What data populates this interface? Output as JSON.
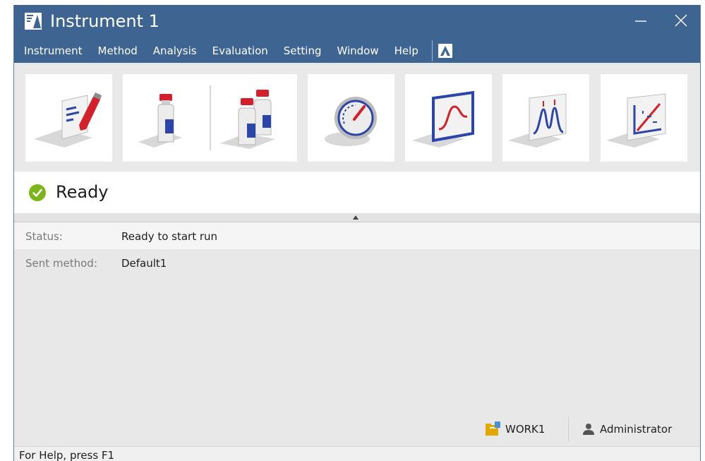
{
  "window": {
    "title": "Instrument 1"
  },
  "colors": {
    "titlebar": "#3e6491",
    "accent_red": "#d4202a",
    "accent_blue": "#2b45a8",
    "status_green": "#7cb518"
  },
  "menu": {
    "items": [
      {
        "label": "Instrument"
      },
      {
        "label": "Method"
      },
      {
        "label": "Analysis"
      },
      {
        "label": "Evaluation"
      },
      {
        "label": "Setting"
      },
      {
        "label": "Window"
      },
      {
        "label": "Help"
      }
    ]
  },
  "toolbar": {
    "buttons": [
      {
        "icon": "method-edit-icon"
      },
      {
        "icon": "single-run-icon"
      },
      {
        "icon": "batch-run-icon"
      },
      {
        "icon": "instrument-monitor-icon"
      },
      {
        "icon": "data-analysis-icon"
      },
      {
        "icon": "peak-chromatogram-icon"
      },
      {
        "icon": "calibration-icon"
      }
    ]
  },
  "status": {
    "text": "Ready",
    "icon": "check-circle-icon"
  },
  "details": {
    "rows": [
      {
        "label": "Status:",
        "value": "Ready to start run"
      },
      {
        "label": "Sent method:",
        "value": "Default1"
      }
    ]
  },
  "footer": {
    "workspace": "WORK1",
    "user": "Administrator"
  },
  "statusbar": {
    "help_text": "For Help, press F1"
  }
}
